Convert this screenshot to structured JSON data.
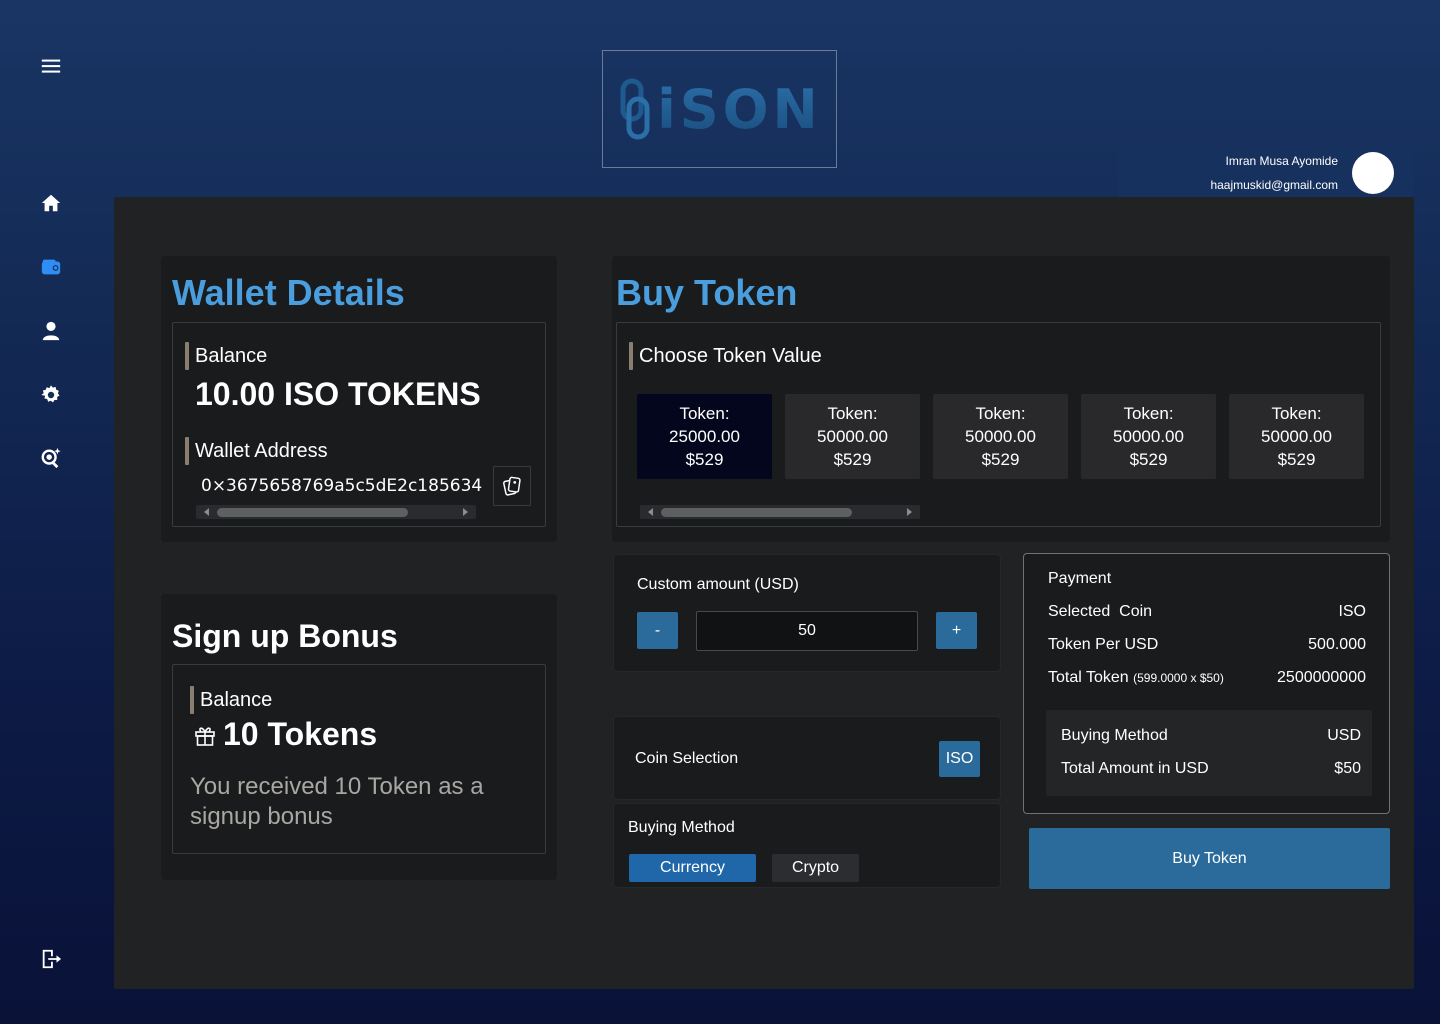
{
  "brand": {
    "logo_text": "iSON"
  },
  "user": {
    "name": "Imran Musa Ayomide",
    "email": "haajmuskid@gmail.com"
  },
  "sidebar": {
    "items": [
      {
        "icon": "menu-icon"
      },
      {
        "icon": "home-icon"
      },
      {
        "icon": "wallet-icon",
        "active": true
      },
      {
        "icon": "user-icon"
      },
      {
        "icon": "gear-icon"
      },
      {
        "icon": "search-icon"
      },
      {
        "icon": "logout-icon"
      }
    ],
    "active_color": "#2f8df5"
  },
  "wallet": {
    "title": "Wallet Details",
    "balance_label": "Balance",
    "balance_value": "10.00 ISO TOKENS",
    "address_label": "Wallet Address",
    "address_value": "0×3675658769a5c5dE2c185634"
  },
  "bonus": {
    "title": "Sign up Bonus",
    "balance_label": "Balance",
    "tokens": "10 Tokens",
    "message": "You received 10 Token as a signup bonus"
  },
  "buy": {
    "title": "Buy Token",
    "choose_label": "Choose Token Value",
    "options": [
      {
        "line1": "Token:",
        "line2": "25000.00",
        "line3": "$529",
        "selected": true
      },
      {
        "line1": "Token:",
        "line2": "50000.00",
        "line3": "$529"
      },
      {
        "line1": "Token:",
        "line2": "50000.00",
        "line3": "$529"
      },
      {
        "line1": "Token:",
        "line2": "50000.00",
        "line3": "$529"
      },
      {
        "line1": "Token:",
        "line2": "50000.00",
        "line3": "$529"
      }
    ]
  },
  "custom": {
    "label": "Custom amount (USD)",
    "minus": "-",
    "plus": "+",
    "value": "50"
  },
  "coin_selection": {
    "label": "Coin Selection",
    "value": "ISO"
  },
  "buying_method": {
    "label": "Buying Method",
    "options": [
      "Currency",
      "Crypto"
    ],
    "selected": "Currency"
  },
  "payment": {
    "title": "Payment",
    "selected_coin_label": "Selected  Coin",
    "selected_coin_value": "ISO",
    "token_per_usd_label": "Token Per USD",
    "token_per_usd_value": "500.000",
    "total_token_label": "Total Token",
    "total_token_formula": "(599.0000 x $50)",
    "total_token_value": "2500000000",
    "buying_method_label": "Buying Method",
    "buying_method_value": "USD",
    "total_amount_label": "Total Amount in USD",
    "total_amount_value": "$50"
  },
  "buy_button": "Buy Token",
  "colors": {
    "accent_blue": "#4b9ede",
    "button_blue": "#2a6b9b",
    "panel": "#212224",
    "card": "#1a1b1d"
  }
}
